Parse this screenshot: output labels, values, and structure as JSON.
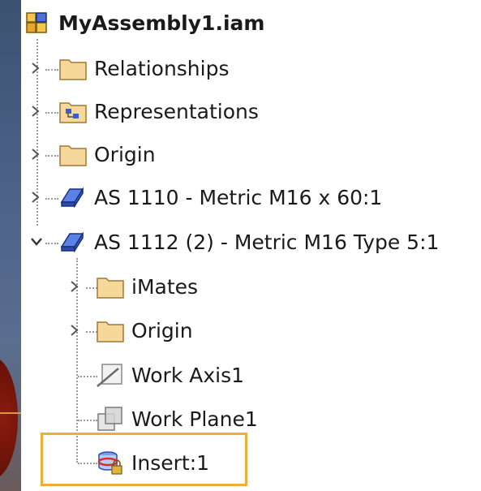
{
  "tree": {
    "root": {
      "label": "MyAssembly1.iam",
      "icon": "assembly-icon"
    },
    "items": [
      {
        "label": "Relationships",
        "icon": "folder-icon",
        "expand": "collapsed"
      },
      {
        "label": "Representations",
        "icon": "representations-icon",
        "expand": "collapsed"
      },
      {
        "label": "Origin",
        "icon": "folder-icon",
        "expand": "collapsed"
      },
      {
        "label": "AS 1110 - Metric M16 x 60:1",
        "icon": "part-icon",
        "expand": "collapsed"
      },
      {
        "label": "AS 1112 (2) - Metric M16  Type 5:1",
        "icon": "part-icon",
        "expand": "expanded",
        "children": [
          {
            "label": "iMates",
            "icon": "folder-icon",
            "expand": "collapsed"
          },
          {
            "label": "Origin",
            "icon": "folder-icon",
            "expand": "collapsed"
          },
          {
            "label": "Work Axis1",
            "icon": "work-axis-icon"
          },
          {
            "label": "Work Plane1",
            "icon": "work-plane-icon"
          },
          {
            "label": "Insert:1",
            "icon": "insert-constraint-icon",
            "highlighted": true
          }
        ]
      }
    ]
  },
  "colors": {
    "highlight_border": "#f0ac36",
    "folder_fill": "#f5d89a",
    "part_blue": "#3a5fc9"
  }
}
